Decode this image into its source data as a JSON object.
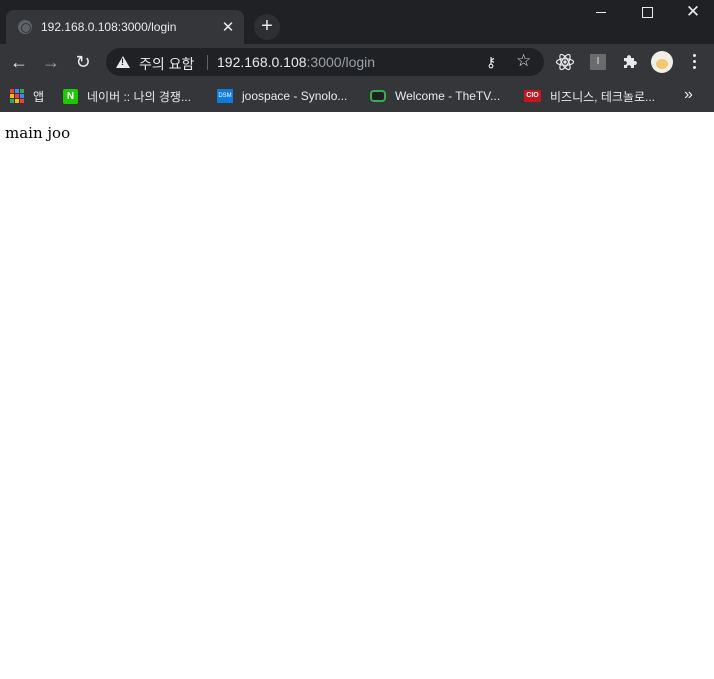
{
  "tab": {
    "title": "192.168.0.108:3000/login",
    "close": "✕"
  },
  "new_tab": "+",
  "window_controls": {
    "close": "✕"
  },
  "toolbar": {
    "back": "←",
    "forward": "→",
    "reload": "↻",
    "security_label": "주의 요함",
    "url_host": "192.168.0.108",
    "url_path": ":3000/login",
    "key": "⚷",
    "star": "☆",
    "extension_i": "I"
  },
  "bookmarks": {
    "apps_label": "앱",
    "items": [
      {
        "label": "네이버 :: 나의 경쟁...",
        "icon": "N"
      },
      {
        "label": "joospace - Synolo...",
        "icon": "DSM"
      },
      {
        "label": "Welcome - TheTV...",
        "icon": ""
      },
      {
        "label": "비즈니스, 테크놀로...",
        "icon": "CIO"
      }
    ],
    "more": "»"
  },
  "page": {
    "text": "main joo"
  },
  "colors": {
    "frame": "#202124",
    "toolbar": "#35363a",
    "naver": "#1ec800",
    "dsm": "#0f7bda",
    "tvd": "#35b04a",
    "cio": "#c4161c",
    "apps_grid": [
      "#ea4335",
      "#4285f4",
      "#34a853",
      "#fbbc05",
      "#ea4335",
      "#4285f4",
      "#34a853",
      "#fbbc05",
      "#ea4335"
    ]
  }
}
